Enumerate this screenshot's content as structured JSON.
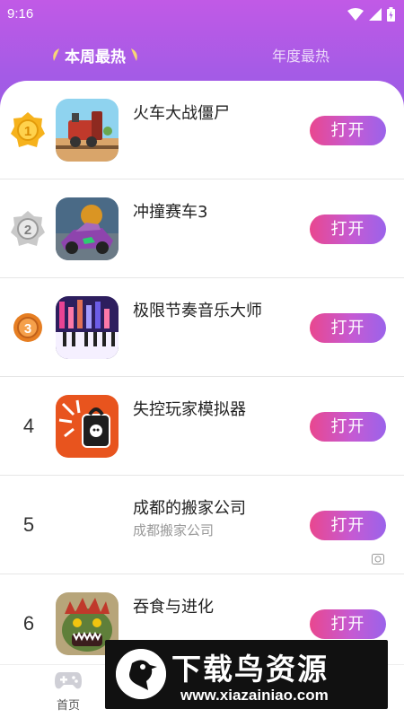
{
  "status_bar": {
    "time": "9:16"
  },
  "tabs": [
    {
      "label": "本周最热",
      "active": true
    },
    {
      "label": "年度最热",
      "active": false
    }
  ],
  "colors": {
    "header_gradient_top": "#c15ae6",
    "header_gradient_bottom": "#9a5ce4",
    "button_gradient_start": "#e9478f",
    "button_gradient_end": "#9b63ea"
  },
  "ranking": [
    {
      "rank": "1",
      "medal": "gold-medal-icon",
      "name": "火车大战僵尸",
      "subtitle": "",
      "button": "打开",
      "icon": "train-game-icon"
    },
    {
      "rank": "2",
      "medal": "silver-medal-icon",
      "name": "冲撞赛车3",
      "subtitle": "",
      "button": "打开",
      "icon": "racing-car-icon"
    },
    {
      "rank": "3",
      "medal": "bronze-medal-icon",
      "name": "极限节奏音乐大师",
      "subtitle": "",
      "button": "打开",
      "icon": "piano-icon"
    },
    {
      "rank": "4",
      "medal": "",
      "name": "失控玩家模拟器",
      "subtitle": "",
      "button": "打开",
      "icon": "explosion-bag-icon"
    },
    {
      "rank": "5",
      "medal": "",
      "name": "成都的搬家公司",
      "subtitle": "成都搬家公司",
      "button": "打开",
      "icon": "",
      "ad": true
    },
    {
      "rank": "6",
      "medal": "",
      "name": "吞食与进化",
      "subtitle": "",
      "button": "打开",
      "icon": "dinosaur-icon"
    }
  ],
  "bottom_nav": {
    "home_label": "首页"
  },
  "watermark": {
    "title": "下载鸟资源",
    "url": "www.xiazainiao.com"
  }
}
